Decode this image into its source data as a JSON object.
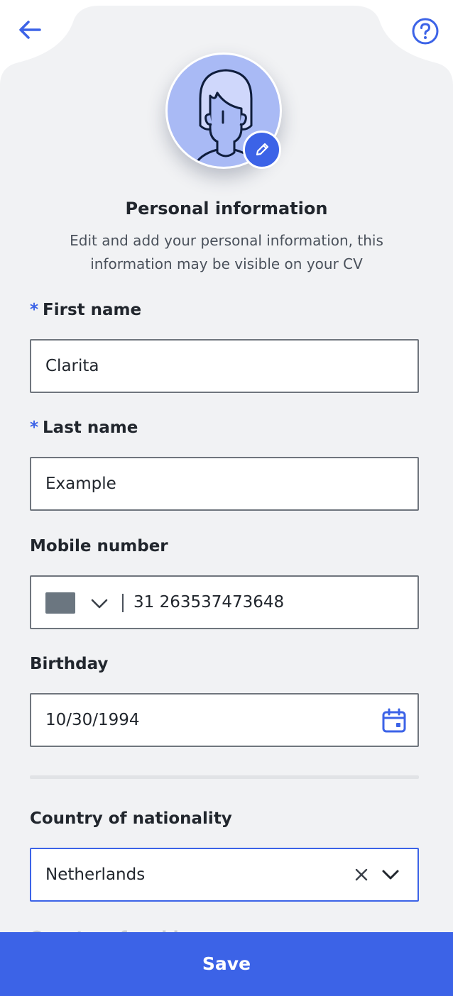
{
  "header": {
    "back_icon": "arrow-left-icon",
    "help_icon": "question-circle-icon"
  },
  "profile": {
    "avatar_icon": "person-avatar-illustration",
    "edit_icon": "pencil-icon",
    "title": "Personal information",
    "subtitle": "Edit and add your personal information, this information may be visible on your CV"
  },
  "form": {
    "first_name": {
      "required_mark": "*",
      "label": "First name",
      "value": "Clarita"
    },
    "last_name": {
      "required_mark": "*",
      "label": "Last name",
      "value": "Example"
    },
    "mobile": {
      "label": "Mobile number",
      "flag_icon": "country-flag-placeholder",
      "value": "31 263537473648"
    },
    "birthday": {
      "label": "Birthday",
      "value": "10/30/1994",
      "icon": "calendar-icon"
    },
    "nationality": {
      "label": "Country of nationality",
      "value": "Netherlands",
      "clear_icon": "close-icon",
      "dropdown_icon": "chevron-down-icon"
    },
    "next_label_peek": "Country of residence"
  },
  "footer": {
    "save_label": "Save"
  },
  "colors": {
    "accent": "#3c63e7",
    "card_background": "#f1f2f4",
    "text_primary": "#21262d",
    "text_secondary": "#4a515b",
    "field_border": "#6f757d"
  }
}
